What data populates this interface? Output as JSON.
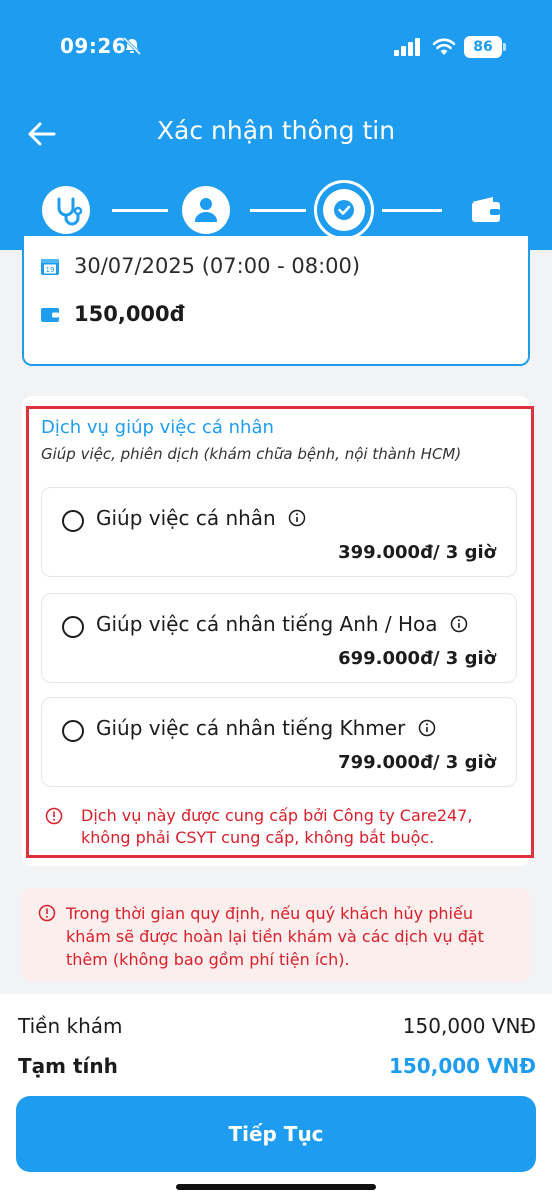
{
  "status_bar": {
    "time": "09:26",
    "battery": "86"
  },
  "header": {
    "title": "Xác nhận thông tin"
  },
  "booking": {
    "date_time": "30/07/2025 (07:00 - 08:00)",
    "calendar_day": "19",
    "price": "150,000đ"
  },
  "service": {
    "title": "Dịch vụ giúp việc cá nhân",
    "subtitle": "Giúp việc, phiên dịch (khám chữa bệnh, nội thành HCM)",
    "options": [
      {
        "label": "Giúp việc cá nhân",
        "price": "399.000đ/ 3 giờ"
      },
      {
        "label": "Giúp việc cá nhân tiếng Anh / Hoa",
        "price": "699.000đ/ 3 giờ"
      },
      {
        "label": "Giúp việc cá nhân tiếng Khmer",
        "price": "799.000đ/ 3 giờ"
      }
    ],
    "note": "Dịch vụ này được cung cấp bởi Công ty Care247, không phải CSYT cung cấp, không bắt buộc."
  },
  "notice": "Trong thời gian quy định, nếu quý khách hủy phiếu khám sẽ được hoàn lại tiền khám và các dịch vụ đặt thêm (không bao gồm phí tiện ích).",
  "summary": {
    "exam_label": "Tiền khám",
    "exam_value": "150,000 VNĐ",
    "subtotal_label": "Tạm tính",
    "subtotal_value": "150,000 VNĐ"
  },
  "cta_label": "Tiếp Tục",
  "colors": {
    "primary": "#1e9df0",
    "alert": "#d8202b",
    "alert_bg": "#fdeeee"
  }
}
